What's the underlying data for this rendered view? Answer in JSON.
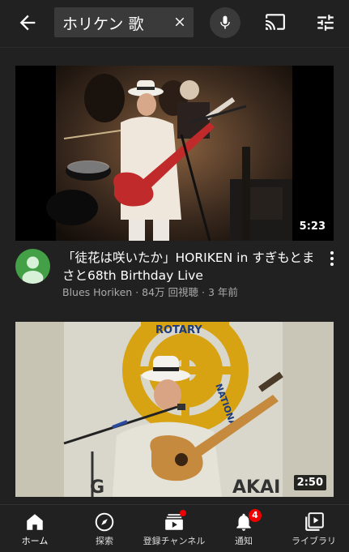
{
  "search": {
    "query": "ホリケン 歌"
  },
  "videos": [
    {
      "duration": "5:23",
      "title": "「徒花は咲いたか」HORIKEN in すぎもとまさと68th Birthday Live",
      "channel": "Blues Horiken",
      "views": "84万 回視聴",
      "age": "3 年前",
      "meta_sep": " · "
    },
    {
      "duration": "2:50",
      "thumbnail_text": [
        "ROTARY",
        "NATIONAL",
        "G",
        "AKAI"
      ]
    }
  ],
  "bottom_nav": [
    {
      "label": "ホーム",
      "icon": "home-icon",
      "active": true
    },
    {
      "label": "探索",
      "icon": "explore-icon"
    },
    {
      "label": "登録チャンネル",
      "icon": "subscriptions-icon",
      "has_dot": true
    },
    {
      "label": "通知",
      "icon": "bell-icon",
      "badge": "4"
    },
    {
      "label": "ライブラリ",
      "icon": "library-icon"
    }
  ],
  "colors": {
    "background": "#212121",
    "badge": "#ee0000",
    "avatar": "#43a047"
  }
}
